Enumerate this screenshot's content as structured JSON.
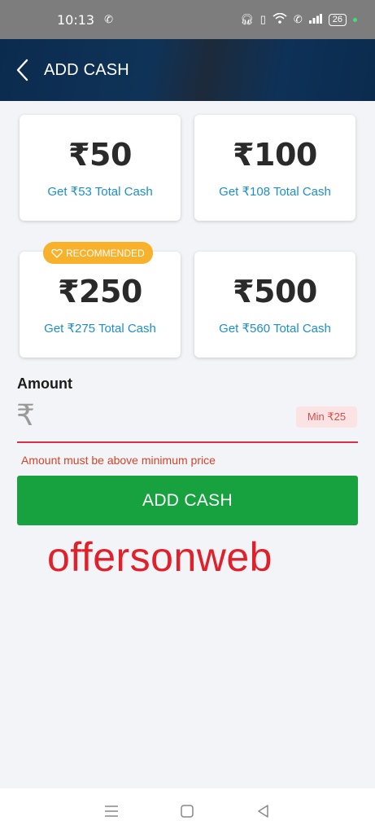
{
  "status_bar": {
    "time": "10:13",
    "battery": "26"
  },
  "header": {
    "title": "ADD CASH"
  },
  "packs": [
    {
      "price": "₹50",
      "subtitle": "Get ₹53 Total Cash"
    },
    {
      "price": "₹100",
      "subtitle": "Get ₹108 Total Cash"
    },
    {
      "price": "₹250",
      "subtitle": "Get ₹275 Total Cash",
      "badge": "RECOMMENDED"
    },
    {
      "price": "₹500",
      "subtitle": "Get ₹560 Total Cash"
    }
  ],
  "amount": {
    "label": "Amount",
    "currency_symbol": "₹",
    "value": "",
    "min_hint": "Min ₹25",
    "error": "Amount must be above minimum price"
  },
  "actions": {
    "add_cash_label": "ADD CASH"
  },
  "watermark": "offersonweb",
  "colors": {
    "header_bg": "#0b2b4e",
    "accent_blue": "#1e8ec9",
    "button_green": "#17a23f",
    "badge_orange": "#f7b12b",
    "error_red": "#d4442a"
  },
  "icons": {
    "back": "chevron-left-icon",
    "badge": "heart-icon",
    "nav": [
      "menu-icon",
      "home-square-icon",
      "back-triangle-icon"
    ]
  }
}
